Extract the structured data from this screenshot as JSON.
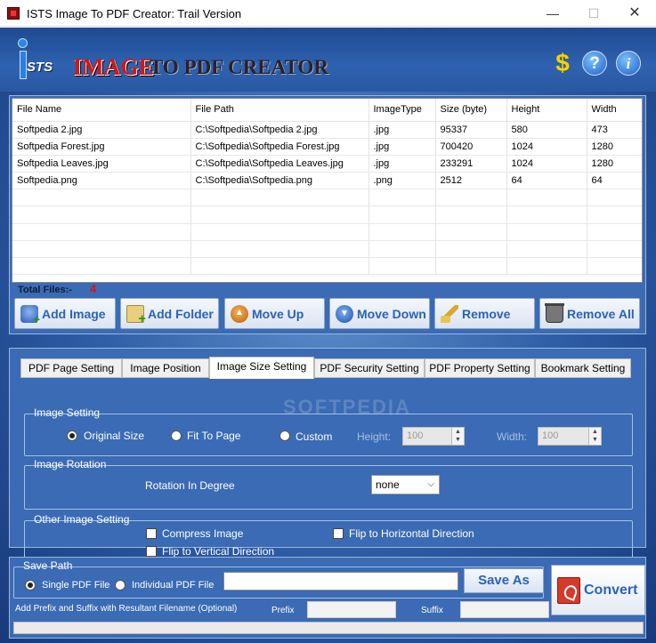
{
  "window": {
    "title": "ISTS Image To PDF Creator: Trail Version",
    "min_glyph": "—",
    "max_glyph": "☐",
    "close_glyph": "✕"
  },
  "banner": {
    "logo_i": "i",
    "logo_sts": "STS",
    "logo_word1": "IMAGE",
    "logo_word2": "TO PDF CREATOR",
    "icons": [
      "dollar-icon",
      "help-icon",
      "info-icon"
    ],
    "dollar_glyph": "$",
    "help_glyph": "?",
    "info_glyph": "i"
  },
  "file_table": {
    "columns": [
      "File Name",
      "File Path",
      "ImageType",
      "Size (byte)",
      "Height",
      "Width"
    ],
    "rows": [
      [
        "Softpedia 2.jpg",
        "C:\\Softpedia\\Softpedia 2.jpg",
        ".jpg",
        "95337",
        "580",
        "473"
      ],
      [
        "Softpedia Forest.jpg",
        "C:\\Softpedia\\Softpedia Forest.jpg",
        ".jpg",
        "700420",
        "1024",
        "1280"
      ],
      [
        "Softpedia Leaves.jpg",
        "C:\\Softpedia\\Softpedia Leaves.jpg",
        ".jpg",
        "233291",
        "1024",
        "1280"
      ],
      [
        "Softpedia.png",
        "C:\\Softpedia\\Softpedia.png",
        ".png",
        "2512",
        "64",
        "64"
      ]
    ],
    "total_label": "Total Files:-",
    "total_count": "4"
  },
  "actions": {
    "add_image": "Add Image",
    "add_folder": "Add Folder",
    "move_up": "Move Up",
    "move_down": "Move Down",
    "remove": "Remove",
    "remove_all": "Remove All"
  },
  "tabs": [
    {
      "label": "PDF Page Setting",
      "active": false
    },
    {
      "label": "Image Position",
      "active": false
    },
    {
      "label": "Image Size Setting",
      "active": true
    },
    {
      "label": "PDF Security Setting",
      "active": false
    },
    {
      "label": "PDF Property Setting",
      "active": false
    },
    {
      "label": "Bookmark Setting",
      "active": false
    }
  ],
  "watermark": "SOFTPEDIA",
  "image_setting": {
    "title": "Image Setting",
    "original_size": "Original Size",
    "fit_to_page": "Fit To Page",
    "custom": "Custom",
    "selected": "Original Size",
    "height_label": "Height:",
    "height_value": "100",
    "width_label": "Width:",
    "width_value": "100"
  },
  "image_rotation": {
    "title": "Image Rotation",
    "label": "Rotation In Degree",
    "value": "none"
  },
  "other_setting": {
    "title": "Other Image Setting",
    "compress": "Compress Image",
    "flip_h": "Flip to Horizontal Direction",
    "flip_v": "Flip to Vertical Direction"
  },
  "save": {
    "title": "Save Path",
    "single": "Single PDF File",
    "individual": "Individual PDF File",
    "selected": "Single PDF File",
    "path_value": "",
    "save_as": "Save As",
    "convert": "Convert",
    "prefix_note": "Add Prefix and Suffix with Resultant Filename (Optional)",
    "prefix_label": "Prefix",
    "prefix_value": "",
    "suffix_label": "Suffix",
    "suffix_value": ""
  },
  "progress": {
    "value": 0
  },
  "colors": {
    "accent": "#2a62b8",
    "panel": "#3a6bb4",
    "total_count": "#e01010"
  }
}
